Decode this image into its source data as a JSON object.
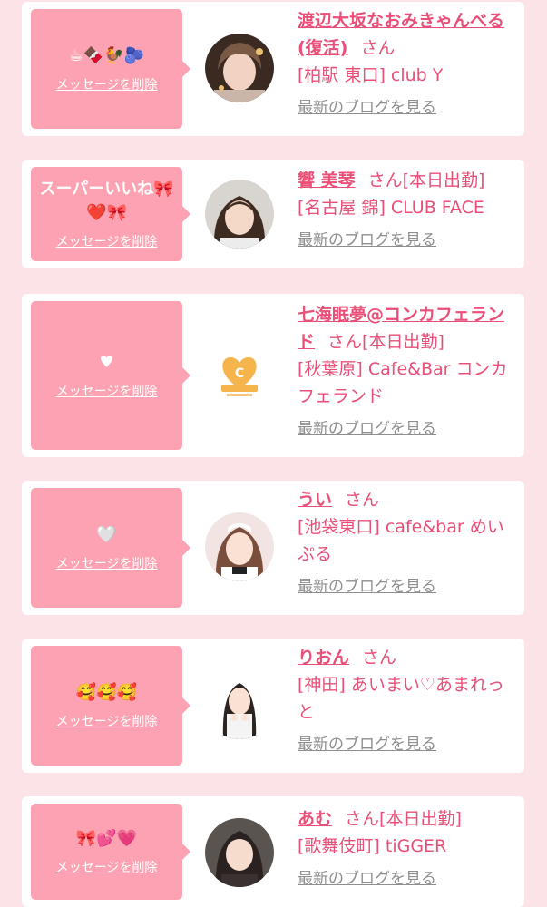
{
  "common": {
    "delete_label": "メッセージを削除",
    "san": "さん",
    "blog_label": "最新のブログを見る"
  },
  "colors": {
    "accent": "#e94f77",
    "bubble": "#fda2b2",
    "background": "#fbe3e8",
    "link_gray": "#8e8e8e"
  },
  "entries": [
    {
      "message": "☕🍫🐓🫐",
      "name": "渡辺大坂なおみきゃんべる(復活)",
      "status": "",
      "shop": "[柏駅 東口] club Y",
      "avatar": "photo"
    },
    {
      "message": "スーパーいいね🎀❤️🎀",
      "name": "響 美琴",
      "status": "[本日出勤]",
      "shop": "[名古屋 錦] CLUB FACE",
      "avatar": "photo"
    },
    {
      "message": "♥",
      "name": "七海眠夢@コンカフェランド",
      "status": "[本日出勤]",
      "shop": "[秋葉原] Cafe&Bar コンカフェランド",
      "avatar": "heart-logo"
    },
    {
      "message": "🤍",
      "name": "うい",
      "status": "",
      "shop": "[池袋東口] cafe&bar めいぷる",
      "avatar": "photo"
    },
    {
      "message": "🥰🥰🥰",
      "name": "りおん",
      "status": "",
      "shop": "[神田] あいまい♡あまれっと",
      "avatar": "photo"
    },
    {
      "message": "🎀💕💗",
      "name": "あむ",
      "status": "[本日出勤]",
      "shop": "[歌舞伎町] tiGGER",
      "avatar": "photo"
    }
  ]
}
